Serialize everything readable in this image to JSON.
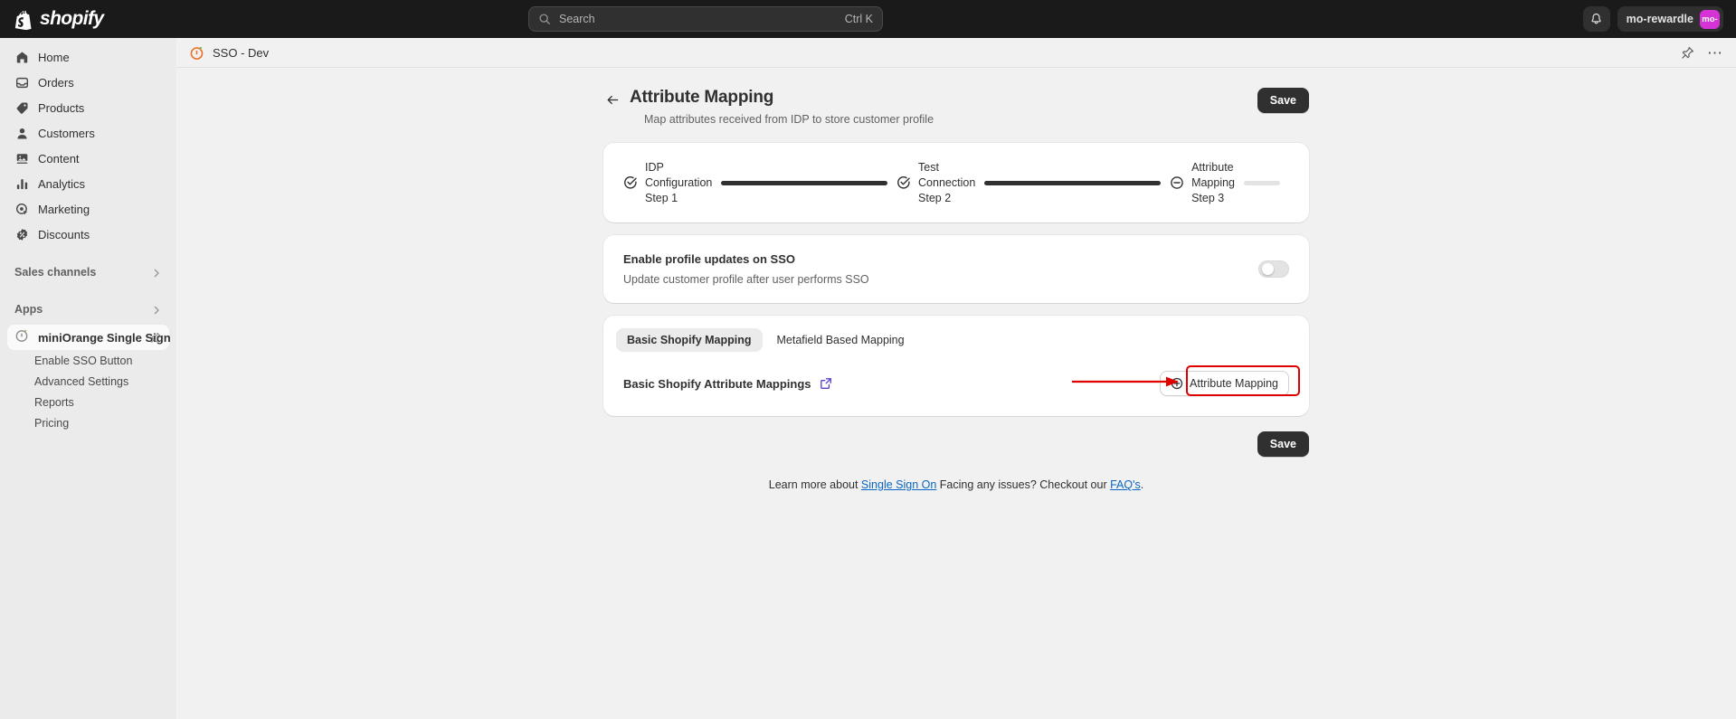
{
  "topbar": {
    "brand": "shopify",
    "brand_icon": "shopify-bag-icon",
    "search": {
      "placeholder": "Search",
      "shortcut": "Ctrl K",
      "icon": "search-icon"
    },
    "notifications_icon": "bell-icon",
    "store_name": "mo-rewardle",
    "avatar_initials": "mo-",
    "avatar_color": "#d633d6"
  },
  "sidebar": {
    "items": [
      {
        "label": "Home",
        "icon": "home-icon"
      },
      {
        "label": "Orders",
        "icon": "orders-inbox-icon"
      },
      {
        "label": "Products",
        "icon": "product-tag-icon"
      },
      {
        "label": "Customers",
        "icon": "person-icon"
      },
      {
        "label": "Content",
        "icon": "content-image-icon"
      },
      {
        "label": "Analytics",
        "icon": "bar-chart-icon"
      },
      {
        "label": "Marketing",
        "icon": "marketing-target-icon"
      },
      {
        "label": "Discounts",
        "icon": "discount-badge-icon"
      }
    ],
    "sections": [
      {
        "label": "Sales channels",
        "icon": "chevron-right-icon"
      },
      {
        "label": "Apps",
        "icon": "chevron-right-icon"
      }
    ],
    "app": {
      "label": "miniOrange Single Sign",
      "icon": "miniorange-icon",
      "pin_icon": "pin-icon",
      "sub_items": [
        {
          "label": "Enable SSO Button"
        },
        {
          "label": "Advanced Settings"
        },
        {
          "label": "Reports"
        },
        {
          "label": "Pricing"
        }
      ]
    }
  },
  "app_header": {
    "title": "SSO - Dev",
    "icon": "miniorange-icon",
    "pin_icon": "pin-icon",
    "more_icon": "ellipsis-icon"
  },
  "page": {
    "back_icon": "arrow-left-icon",
    "title": "Attribute Mapping",
    "subtitle": "Map attributes received from IDP to store customer profile",
    "save_label": "Save",
    "save_label_bottom": "Save"
  },
  "stepper": {
    "steps": [
      {
        "line1": "IDP",
        "line2": "Configuration",
        "line3": "Step 1",
        "icon": "check-circle-icon",
        "state": "complete",
        "bar": "filled"
      },
      {
        "line1": "Test",
        "line2": "Connection",
        "line3": "Step 2",
        "icon": "check-circle-icon",
        "state": "complete",
        "bar": "filled"
      },
      {
        "line1": "Attribute",
        "line2": "Mapping",
        "line3": "Step 3",
        "icon": "minus-circle-icon",
        "state": "incomplete",
        "bar": "empty"
      }
    ]
  },
  "profile_updates": {
    "title": "Enable profile updates on SSO",
    "description": "Update customer profile after user performs SSO",
    "toggle_state": "off"
  },
  "mapping": {
    "tabs": [
      {
        "label": "Basic Shopify Mapping",
        "active": true
      },
      {
        "label": "Metafield Based Mapping",
        "active": false
      }
    ],
    "row_label": "Basic Shopify Attribute Mappings",
    "external_link_icon": "external-link-icon",
    "attribute_button": {
      "label": "Attribute Mapping",
      "icon": "plus-circle-icon"
    },
    "annotation": {
      "highlight_color": "#e00000",
      "arrow_icon": "arrow-right-annotation"
    }
  },
  "footer": {
    "text_before": "Learn more about ",
    "link1": "Single Sign On",
    "text_middle": " Facing any issues? Checkout our ",
    "link2": "FAQ's",
    "text_after": ".",
    "link_color": "#0a66c2"
  }
}
